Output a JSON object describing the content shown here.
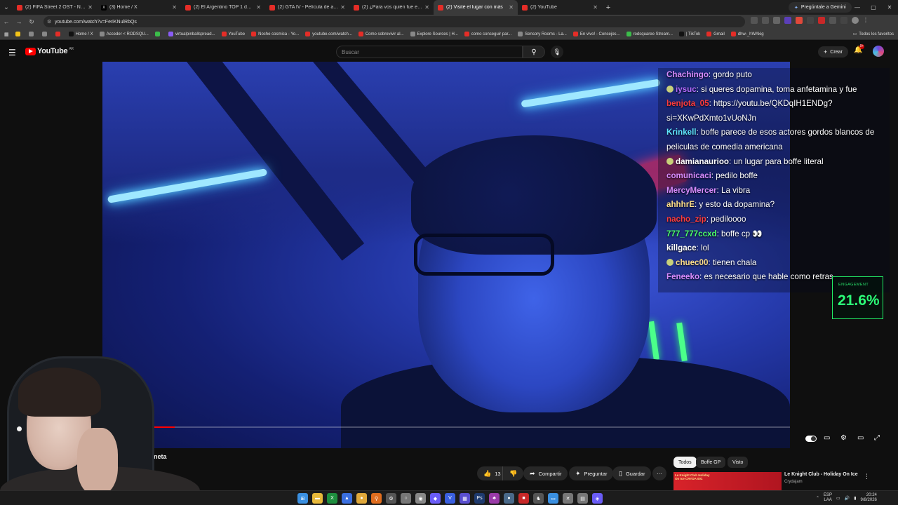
{
  "browser": {
    "tabs": [
      {
        "label": "(2) FIFA Street 2 OST - No Time",
        "favicon": "youtube-icon",
        "active": false
      },
      {
        "label": "(3) Home / X",
        "favicon": "x-icon",
        "active": false
      },
      {
        "label": "(2) El Argentino TOP 1 de Sma",
        "favicon": "youtube-icon",
        "active": false
      },
      {
        "label": "(2) GTA IV - Película de acción",
        "favicon": "youtube-icon",
        "active": false
      },
      {
        "label": "(2) ¿Para vos quién fue el más",
        "favicon": "youtube-icon",
        "active": false
      },
      {
        "label": "(2) Visité el lugar con más",
        "favicon": "youtube-icon",
        "active": true
      },
      {
        "label": "(2) YouTube",
        "favicon": "youtube-icon",
        "active": false
      }
    ],
    "tab_close": "✕",
    "new_tab": "+",
    "gemini_label": "Pregúntale a Gemini",
    "url": "youtube.com/watch?v=FeriKNulRbQs",
    "bookmarks": [
      {
        "label": "",
        "color": "#f2c318"
      },
      {
        "label": "",
        "color": "#888888"
      },
      {
        "label": "",
        "color": "#888888"
      },
      {
        "label": "",
        "color": "#e52d27"
      },
      {
        "label": "Home / X",
        "color": "#111111"
      },
      {
        "label": "Acceder < RODSQU...",
        "color": "#888888"
      },
      {
        "label": "",
        "color": "#3bbd4a"
      },
      {
        "label": "virtualpinballspread...",
        "color": "#8a5cf6"
      },
      {
        "label": "YouTube",
        "color": "#e52d27"
      },
      {
        "label": "Noche cosmica - Yo...",
        "color": "#e52d27"
      },
      {
        "label": "youtube.com/watch...",
        "color": "#e52d27"
      },
      {
        "label": "Como sobrevivir al...",
        "color": "#e52d27"
      },
      {
        "label": "Explore Sources | H...",
        "color": "#888888"
      },
      {
        "label": "como conseguir par...",
        "color": "#e52d27"
      },
      {
        "label": "Sensory Rooms - La...",
        "color": "#888888"
      },
      {
        "label": "En vivo! - Consejos...",
        "color": "#e52d27"
      },
      {
        "label": "rodsquaree Stream...",
        "color": "#3bbd4a"
      },
      {
        "label": "| TikTok",
        "color": "#111111"
      },
      {
        "label": "Gmail",
        "color": "#e52d27"
      },
      {
        "label": "dhw-_hWAkig",
        "color": "#e52d27"
      }
    ],
    "all_bookmarks": "Todos los favoritos"
  },
  "youtube": {
    "logo_text": "YouTube",
    "logo_country": "AR",
    "search_placeholder": "Buscar",
    "create_label": "Crear",
    "notif_count": "9+",
    "channel_name": "aneta",
    "actions": {
      "like_count": "13",
      "share": "Compartir",
      "ask": "Preguntar",
      "save": "Guardar",
      "more": "⋯"
    },
    "chips": [
      "Todos",
      "Boffe GP",
      "Visto"
    ],
    "recommendation": {
      "title": "Le Knight Club - Holiday On Ice",
      "channel": "Crydajam",
      "thumb_text": "Le Knight Club Holiday On Ice CRYDA 001"
    },
    "progress": 0.105
  },
  "chat": [
    {
      "user": "Chachingo",
      "color": "#d88cff",
      "msg": "gordo puto",
      "emote": false
    },
    {
      "user": "iysuc",
      "color": "#b36bff",
      "msg": "si queres dopamina, toma anfetamina y fue",
      "emote": true
    },
    {
      "user": "benjota_05",
      "color": "#ff3b3b",
      "msg": "https://youtu.be/QKDqIH1ENDg?si=XKwPdXmto1vUoNJn",
      "emote": false
    },
    {
      "user": "Krinkell",
      "color": "#5fe8ff",
      "msg": "boffe parece de esos actores gordos blancos de peliculas de comedia americana",
      "emote": false
    },
    {
      "user": "damianaurioo",
      "color": "#ffffff",
      "msg": "un lugar para boffe literal",
      "emote": true
    },
    {
      "user": "comunicaci",
      "color": "#d88cff",
      "msg": "pedilo boffe",
      "emote": false
    },
    {
      "user": "MercyMercer",
      "color": "#d88cff",
      "msg": "La vibra",
      "emote": false
    },
    {
      "user": "ahhhrE",
      "color": "#ffe08a",
      "msg": "y esto da dopamina?",
      "emote": false
    },
    {
      "user": "nacho_zip",
      "color": "#ff3b3b",
      "msg": "pediloooo",
      "emote": false
    },
    {
      "user": "777_777ccxd",
      "color": "#4bff6a",
      "msg": "boffe cp 👀",
      "emote": false
    },
    {
      "user": "killgace",
      "color": "#ffffff",
      "msg": "lol",
      "emote": false
    },
    {
      "user": "chuec00",
      "color": "#ffe08a",
      "msg": "tienen chala",
      "emote": true
    },
    {
      "user": "Feneeko",
      "color": "#d88cff",
      "msg": "es necesario que hable como retras",
      "emote": false
    }
  ],
  "engagement": {
    "label": "ENGAGEMENT",
    "value": "21.6%"
  },
  "taskbar": {
    "icons": [
      {
        "name": "windows-start-icon",
        "color": "#3a8fe0",
        "glyph": "⊞"
      },
      {
        "name": "file-explorer-icon",
        "color": "#e8b93a",
        "glyph": "▬"
      },
      {
        "name": "excel-icon",
        "color": "#1e8e3e",
        "glyph": "X"
      },
      {
        "name": "photos-icon",
        "color": "#3a6fe0",
        "glyph": "▲"
      },
      {
        "name": "chrome-icon",
        "color": "#e0a83a",
        "glyph": "●"
      },
      {
        "name": "search-app-icon",
        "color": "#e06d1e",
        "glyph": "⚲"
      },
      {
        "name": "settings-app-icon",
        "color": "#555555",
        "glyph": "⚙"
      },
      {
        "name": "app-icon-1",
        "color": "#777777",
        "glyph": "○"
      },
      {
        "name": "app-icon-2",
        "color": "#888888",
        "glyph": "◉"
      },
      {
        "name": "app-icon-3",
        "color": "#6a5cf6",
        "glyph": "◆"
      },
      {
        "name": "vscode-icon",
        "color": "#3a5fe0",
        "glyph": "V"
      },
      {
        "name": "app-icon-4",
        "color": "#5a4fd0",
        "glyph": "▦"
      },
      {
        "name": "photoshop-icon",
        "color": "#1e3a6e",
        "glyph": "Ps"
      },
      {
        "name": "app-icon-5",
        "color": "#9a3aa8",
        "glyph": "♣"
      },
      {
        "name": "app-icon-6",
        "color": "#4a6a8a",
        "glyph": "●"
      },
      {
        "name": "app-icon-7",
        "color": "#c82828",
        "glyph": "■"
      },
      {
        "name": "app-icon-8",
        "color": "#555555",
        "glyph": "♞"
      },
      {
        "name": "app-icon-9",
        "color": "#3a8fe0",
        "glyph": "▭"
      },
      {
        "name": "app-icon-10",
        "color": "#777777",
        "glyph": "✕"
      },
      {
        "name": "app-icon-11",
        "color": "#777777",
        "glyph": "▤"
      },
      {
        "name": "app-icon-12",
        "color": "#6a5cf6",
        "glyph": "◈"
      }
    ],
    "lang_top": "ESP",
    "lang_bottom": "LAA",
    "time": "20:24",
    "date": "9/8/2026"
  }
}
